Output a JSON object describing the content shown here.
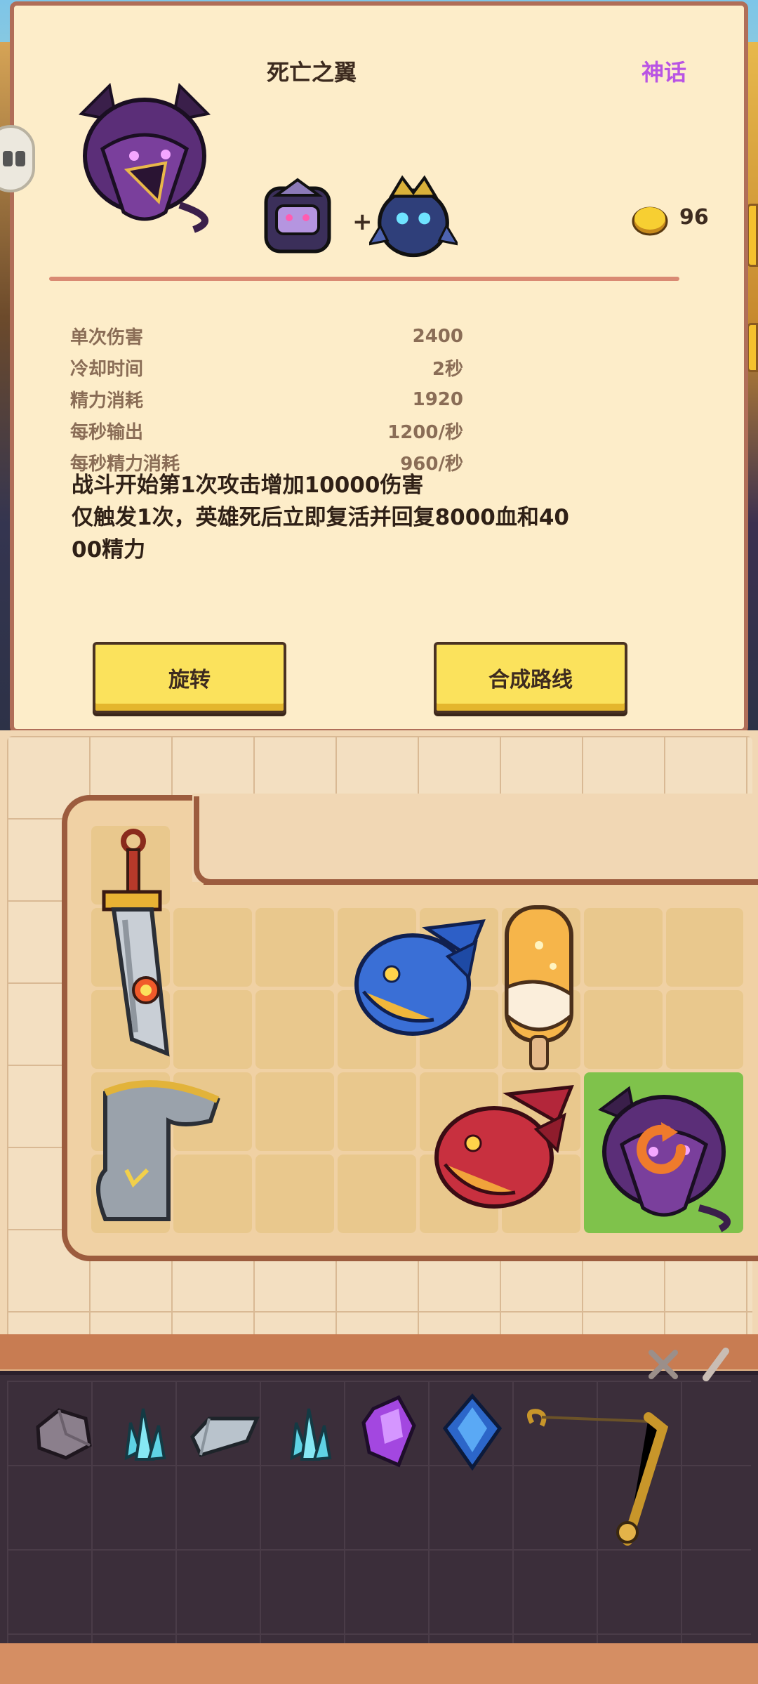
{
  "item": {
    "name": "死亡之翼",
    "rarity": "神话",
    "rarity_color": "#b954e4",
    "price": "96"
  },
  "stats": [
    {
      "label": "单次伤害",
      "value": "2400"
    },
    {
      "label": "冷却时间",
      "value": "2秒"
    },
    {
      "label": "精力消耗",
      "value": "1920"
    },
    {
      "label": "每秒输出",
      "value": "1200/秒"
    },
    {
      "label": "每秒精力消耗",
      "value": "960/秒"
    }
  ],
  "description": {
    "line1": "战斗开始第1次攻击增加10000伤害",
    "line2": "仅触发1次，英雄死后立即复活并回复8000血和40",
    "line3": "00精力"
  },
  "buttons": {
    "rotate": "旋转",
    "route": "合成路线"
  },
  "board_items": [
    {
      "name": "sword-icon"
    },
    {
      "name": "blue-dragon-icon"
    },
    {
      "name": "popsicle-icon"
    },
    {
      "name": "boot-icon"
    },
    {
      "name": "red-dragon-icon"
    },
    {
      "name": "deathwing-icon"
    }
  ],
  "inventory_items": [
    {
      "name": "stone-icon"
    },
    {
      "name": "crystal-cluster-icon"
    },
    {
      "name": "iron-ingot-icon"
    },
    {
      "name": "crystal-cluster-icon"
    },
    {
      "name": "purple-gem-icon"
    },
    {
      "name": "blue-gem-icon"
    },
    {
      "name": "fishing-rod-icon"
    }
  ]
}
